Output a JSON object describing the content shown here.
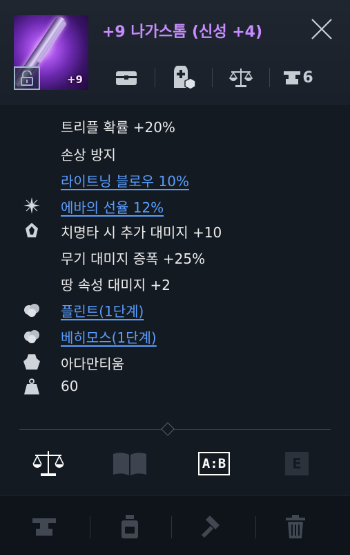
{
  "item": {
    "title": "+9 나가스톰 (신성 +4)",
    "enhance_badge": "+9",
    "title_color": "#c78cff"
  },
  "header_icons": [
    {
      "name": "chest-icon"
    },
    {
      "name": "storage-icon"
    },
    {
      "name": "scale-icon"
    },
    {
      "name": "anvil-icon",
      "count": "6"
    }
  ],
  "stats": {
    "lines": [
      {
        "text": "트리플 확률 +20%",
        "icon": null,
        "link": false
      },
      {
        "text": "손상 방지",
        "icon": null,
        "link": false
      },
      {
        "text": "라이트닝 블로우 10%",
        "icon": null,
        "link": true
      },
      {
        "text": "에바의 선율 12%",
        "icon": "sparkle-icon",
        "link": true
      },
      {
        "text": "치명타 시 추가 대미지 +10",
        "icon": "crystal-icon",
        "link": false
      },
      {
        "text": "무기 대미지 증폭 +25%",
        "icon": null,
        "link": false
      },
      {
        "text": "땅 속성 대미지 +2",
        "icon": null,
        "link": false
      },
      {
        "text": "플린트(1단계)",
        "icon": "ore-icon",
        "link": true
      },
      {
        "text": "베히모스(1단계)",
        "icon": "ore-icon",
        "link": true
      },
      {
        "text": "아다만티움",
        "icon": "material-icon",
        "link": false
      },
      {
        "text": "60",
        "icon": "weight-icon",
        "link": false
      }
    ],
    "link_color": "#5a9eff"
  },
  "tabs": [
    {
      "name": "tab-compare",
      "icon": "scale-icon",
      "active": true
    },
    {
      "name": "tab-book",
      "icon": "book-icon",
      "active": false
    },
    {
      "name": "tab-ab",
      "label": "A:B",
      "active": true
    },
    {
      "name": "tab-e",
      "label": "E",
      "active": false
    }
  ],
  "toolbar": [
    {
      "name": "anvil-button",
      "icon": "anvil-icon"
    },
    {
      "name": "potion-button",
      "icon": "bottle-icon"
    },
    {
      "name": "hammer-button",
      "icon": "hammer-icon"
    },
    {
      "name": "delete-button",
      "icon": "trash-icon"
    }
  ]
}
